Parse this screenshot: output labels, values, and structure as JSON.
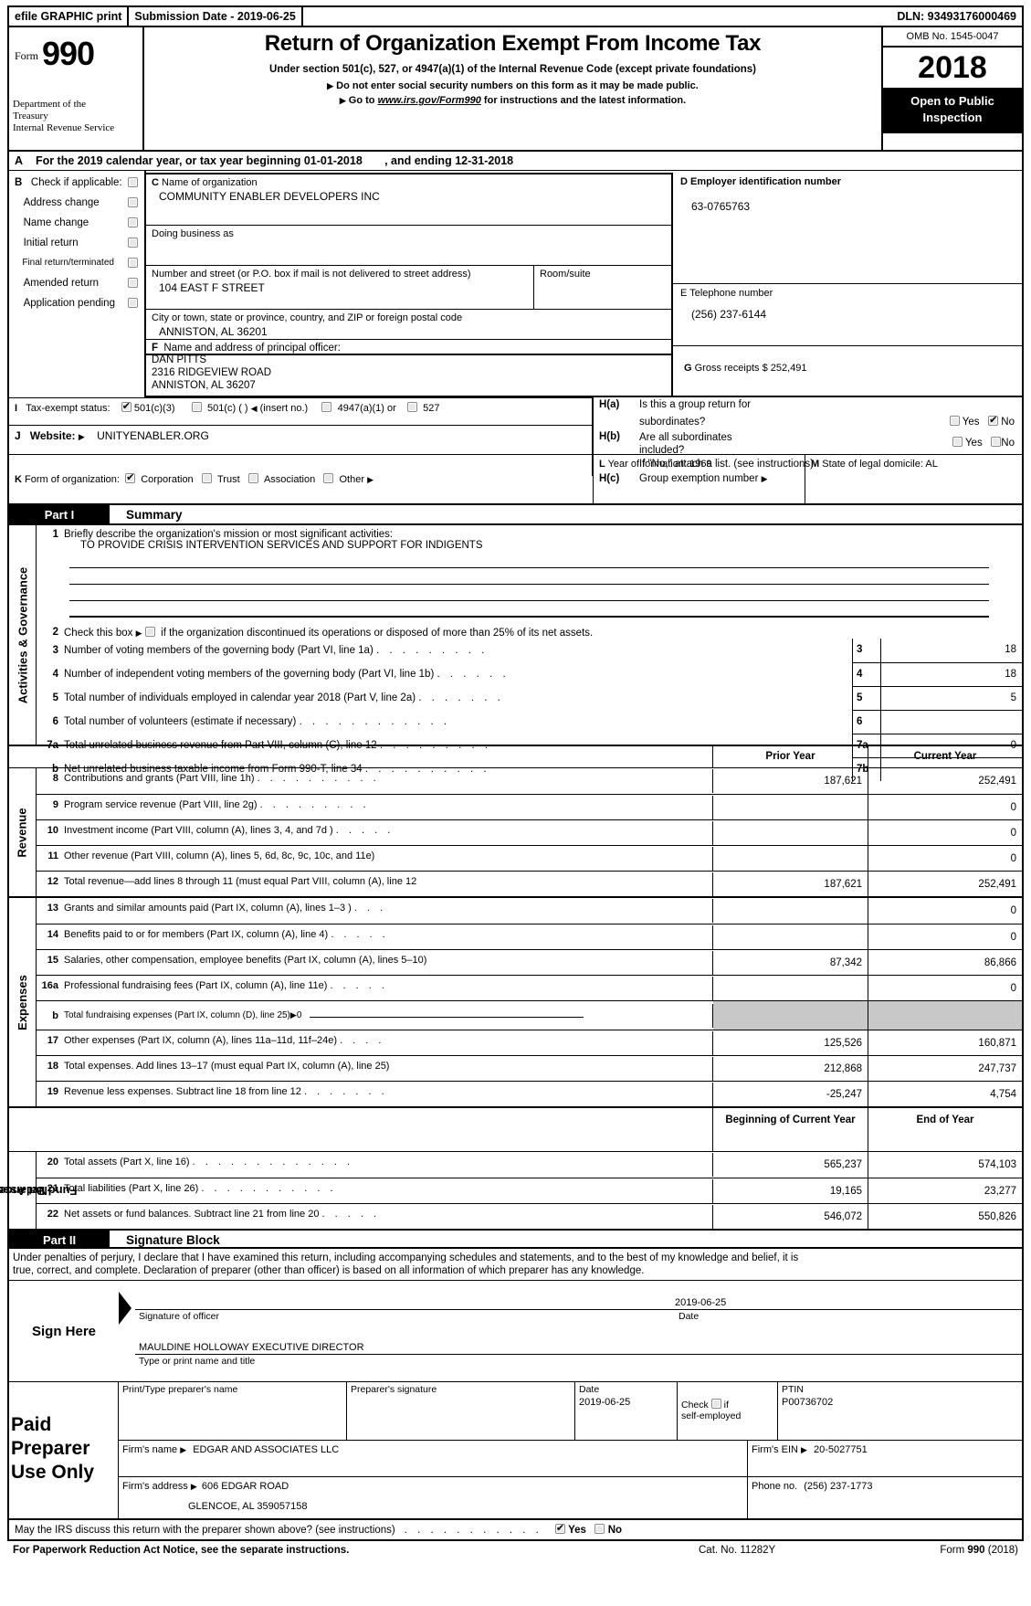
{
  "efile": {
    "graphic_print": "efile GRAPHIC print",
    "submission_label": "Submission Date - 2019-06-25",
    "dln": "DLN: 93493176000469"
  },
  "header": {
    "form_word": "Form",
    "form_number": "990",
    "department": "Department of the Treasury Internal Revenue Service",
    "dept_line1": "Department of the",
    "dept_line2": "Treasury",
    "dept_line3": "Internal Revenue Service",
    "title": "Return of Organization Exempt From Income Tax",
    "subtitle": "Under section 501(c), 527, or 4947(a)(1) of the Internal Revenue Code (except private foundations)",
    "bullet1": "Do not enter social security numbers on this form as it may be made public.",
    "bullet2_pre": "Go to ",
    "bullet2_link": "www.irs.gov/Form990",
    "bullet2_post": " for instructions and the latest information.",
    "omb": "OMB No. 1545-0047",
    "tax_year": "2018",
    "open_to_public_line1": "Open to Public",
    "open_to_public_line2": "Inspection"
  },
  "line_a": {
    "letter": "A",
    "text_pre": "For the 2019 calendar year, or tax year beginning",
    "begin_date": "01-01-2018",
    "text_mid": ", and ending",
    "end_date": "12-31-2018"
  },
  "section_b": {
    "letter": "B",
    "title": "Check if applicable:",
    "options": [
      {
        "label": "Address change",
        "checked": false
      },
      {
        "label": "Name change",
        "checked": false
      },
      {
        "label": "Initial return",
        "checked": false
      },
      {
        "label": "Final return/terminated",
        "checked": false
      },
      {
        "label": "Amended return",
        "checked": false
      },
      {
        "label": "Application pending",
        "checked": false
      }
    ]
  },
  "section_c": {
    "letter": "C",
    "name_label": "Name of organization",
    "org_name": "COMMUNITY ENABLER DEVELOPERS INC",
    "dba_label": "Doing business as",
    "dba_value": "",
    "street_label": "Number and street (or P.O. box if mail is not delivered to street address)",
    "street_value": "104 EAST F STREET",
    "room_label": "Room/suite",
    "room_value": "",
    "city_label": "City or town, state or province, country, and ZIP or foreign postal code",
    "city_value": "ANNISTON, AL   36201"
  },
  "section_d": {
    "label": "D Employer identification number",
    "letter": "D",
    "title": "Employer identification number",
    "value": "63-0765763"
  },
  "section_e": {
    "letter": "E",
    "title": "Telephone number",
    "value": "(256) 237-6144"
  },
  "section_f": {
    "letter": "F",
    "title": "Name and address of principal officer:",
    "name": "DAN PITTS",
    "street": "2316 RIDGEVIEW ROAD",
    "citystate": "ANNISTON, AL   36207"
  },
  "section_g": {
    "letter": "G",
    "label": "Gross receipts $",
    "value": "252,491"
  },
  "section_h": {
    "ha_letter": "H(a)",
    "ha_line1": "Is this a group return for",
    "ha_line2": "subordinates?",
    "ha_yes": "Yes",
    "ha_no": "No",
    "ha_yes_checked": false,
    "ha_no_checked": true,
    "hb_letter": "H(b)",
    "hb_line1": "Are all subordinates",
    "hb_line2": "included?",
    "hb_yes": "Yes",
    "hb_no": "No",
    "hb_yes_checked": false,
    "hb_no_checked": false,
    "hb_note": "If \"No,\" attach a list. (see instructions)",
    "hc_letter": "H(c)",
    "hc_label": "Group exemption number",
    "hc_value": ""
  },
  "section_i": {
    "letter": "I",
    "label": "Tax-exempt status:",
    "options": [
      {
        "label": "501(c)(3)",
        "checked": true
      },
      {
        "label": "501(c) (  )",
        "checked": false,
        "suffix": "(insert no.)"
      },
      {
        "label": "4947(a)(1) or",
        "checked": false
      },
      {
        "label": "527",
        "checked": false
      }
    ]
  },
  "section_j": {
    "letter": "J",
    "label": "Website:",
    "value": "UNITYENABLER.ORG"
  },
  "section_k": {
    "letter": "K",
    "label": "Form of organization:",
    "options": [
      {
        "label": "Corporation",
        "checked": true
      },
      {
        "label": "Trust",
        "checked": false
      },
      {
        "label": "Association",
        "checked": false
      },
      {
        "label": "Other",
        "checked": false
      }
    ]
  },
  "section_l": {
    "letter": "L",
    "label": "Year of formation:",
    "value": "1969"
  },
  "section_m": {
    "letter": "M",
    "label": "State of legal domicile:",
    "value": "AL"
  },
  "part1": {
    "part_label": "Part I",
    "title": "Summary",
    "vlabel_activities": "Activities & Governance",
    "vlabel_revenue": "Revenue",
    "vlabel_expenses": "Expenses",
    "vlabel_netassets_l1": "Net Assets or",
    "vlabel_netassets_l2": "Fund Balances",
    "line1_num": "1",
    "line1_text": "Briefly describe the organization's mission or most significant activities:",
    "mission": "TO PROVIDE CRISIS INTERVENTION SERVICES AND SUPPORT FOR INDIGENTS",
    "line2_num": "2",
    "line2_text_pre": "Check this box",
    "line2_text_post": "if the organization discontinued its operations or disposed of more than 25% of its net assets.",
    "line2_checked": false,
    "count_rows": [
      {
        "num": "3",
        "text": "Number of voting members of the governing body (Part VI, line 1a)",
        "dots": ".    .    .    .    .    .    .    .    .",
        "key": "3",
        "value": "18"
      },
      {
        "num": "4",
        "text": "Number of independent voting members of the governing body (Part VI, line 1b)",
        "dots": ".    .    .    .    .    .",
        "key": "4",
        "value": "18"
      },
      {
        "num": "5",
        "text": "Total number of individuals employed in calendar year 2018 (Part V, line 2a)",
        "dots": ".    .    .    .    .    .    .",
        "key": "5",
        "value": "5"
      },
      {
        "num": "6",
        "text": "Total number of volunteers (estimate if necessary)",
        "dots": ".    .    .    .    .    .    .    .    .    .    .    .",
        "key": "6",
        "value": ""
      },
      {
        "num": "7a",
        "text": "Total unrelated business revenue from Part VIII, column (C), line 12",
        "dots": ".    .    .    .    .    .    .    .    .",
        "key": "7a",
        "value": "0"
      },
      {
        "num": "b",
        "text": "Net unrelated business taxable income from Form 990-T, line 34",
        "dots": ".    .    .    .    .    .    .    .    .    .",
        "key": "7b",
        "value": ""
      }
    ],
    "col_prior": "Prior Year",
    "col_current": "Current Year",
    "col_begin": "Beginning of Current Year",
    "col_end": "End of Year",
    "revenue_rows": [
      {
        "num": "8",
        "text": "Contributions and grants (Part VIII, line 1h)",
        "dots": ".    .    .    .    .    .    .    .    .    .",
        "prior": "187,621",
        "current": "252,491"
      },
      {
        "num": "9",
        "text": "Program service revenue (Part VIII, line 2g)",
        "dots": ".    .    .    .    .    .    .    .    .",
        "prior": "",
        "current": "0"
      },
      {
        "num": "10",
        "text": "Investment income (Part VIII, column (A), lines 3, 4, and 7d )",
        "dots": ".    .    .    .    .",
        "prior": "",
        "current": "0"
      },
      {
        "num": "11",
        "text": "Other revenue (Part VIII, column (A), lines 5, 6d, 8c, 9c, 10c, and 11e)",
        "dots": "",
        "prior": "",
        "current": "0"
      },
      {
        "num": "12",
        "text": "Total revenue—add lines 8 through 11 (must equal Part VIII, column (A), line 12",
        "dots": "",
        "prior": "187,621",
        "current": "252,491"
      }
    ],
    "expense_rows": [
      {
        "num": "13",
        "text": "Grants and similar amounts paid (Part IX, column (A), lines 1–3 )",
        "dots": ".    .    .",
        "prior": "",
        "current": "0",
        "shaded": false
      },
      {
        "num": "14",
        "text": "Benefits paid to or for members (Part IX, column (A), line 4)",
        "dots": ".    .    .    .    .",
        "prior": "",
        "current": "0",
        "shaded": false
      },
      {
        "num": "15",
        "text": "Salaries, other compensation, employee benefits (Part IX, column (A), lines 5–10)",
        "dots": "",
        "prior": "87,342",
        "current": "86,866",
        "shaded": false
      },
      {
        "num": "16a",
        "text": "Professional fundraising fees (Part IX, column (A), line 11e)",
        "dots": ".    .    .    .    .",
        "prior": "",
        "current": "0",
        "shaded": false
      },
      {
        "num": "b",
        "text": "Total fundraising expenses (Part IX, column (D), line 25)",
        "dots": "",
        "prior": "",
        "current": "",
        "shaded": true,
        "fundraising_value": "0"
      },
      {
        "num": "17",
        "text": "Other expenses (Part IX, column (A), lines 11a–11d, 11f–24e)",
        "dots": ".    .    .    .",
        "prior": "125,526",
        "current": "160,871",
        "shaded": false
      },
      {
        "num": "18",
        "text": "Total expenses. Add lines 13–17 (must equal Part IX, column (A), line 25)",
        "dots": "",
        "prior": "212,868",
        "current": "247,737",
        "shaded": false
      },
      {
        "num": "19",
        "text": "Revenue less expenses. Subtract line 18 from line 12",
        "dots": ".    .    .    .    .    .    .",
        "prior": "-25,247",
        "current": "4,754",
        "shaded": false
      }
    ],
    "netasset_rows": [
      {
        "num": "20",
        "text": "Total assets (Part X, line 16)",
        "dots": ".    .    .    .    .    .    .    .    .    .    .    .    .",
        "begin": "565,237",
        "end": "574,103"
      },
      {
        "num": "21",
        "text": "Total liabilities (Part X, line 26)",
        "dots": ".    .    .    .    .    .    .    .    .    .    .",
        "begin": "19,165",
        "end": "23,277"
      },
      {
        "num": "22",
        "text": "Net assets or fund balances. Subtract line 21 from line 20",
        "dots": ".    .    .    .    .",
        "begin": "546,072",
        "end": "550,826"
      }
    ]
  },
  "part2": {
    "part_label": "Part II",
    "title": "Signature Block",
    "perjury_line1": "Under penalties of perjury, I declare that I have examined this return, including accompanying schedules and statements, and to the best of my knowledge and belief, it is",
    "perjury_line2": "true, correct, and complete. Declaration of preparer (other than officer) is based on all information of which preparer has any knowledge.",
    "sign_here": "Sign Here",
    "officer_sig_caption": "Signature of officer",
    "date_caption": "Date",
    "officer_date": "2019-06-25",
    "officer_name_title": "MAULDINE HOLLOWAY  EXECUTIVE DIRECTOR",
    "type_print_caption": "Type or print name and title"
  },
  "preparer": {
    "block_l1": "Paid",
    "block_l2": "Preparer",
    "block_l3": "Use Only",
    "name_caption": "Print/Type preparer's name",
    "name_value": "",
    "sig_caption": "Preparer's signature",
    "sig_value": "",
    "date_caption": "Date",
    "date_value": "2019-06-25",
    "check_label_1": "Check",
    "check_label_2": "if",
    "check_label_3": "self-employed",
    "self_employed_checked": false,
    "ptin_caption": "PTIN",
    "ptin_value": "P00736702",
    "firm_name_caption": "Firm's name",
    "firm_name_value": "EDGAR AND ASSOCIATES LLC",
    "firm_ein_caption": "Firm's EIN",
    "firm_ein_value": "20-5027751",
    "firm_address_caption": "Firm's address",
    "firm_address_value": "606 EDGAR ROAD",
    "firm_address_value2": "GLENCOE, AL   359057158",
    "phone_caption": "Phone no.",
    "phone_value": "(256) 237-1773"
  },
  "footer": {
    "discuss_text": "May the IRS discuss this return with the preparer shown above? (see instructions)",
    "discuss_dots": ".    .    .    .    .    .    .    .    .    .    .",
    "yes": "Yes",
    "no": "No",
    "yes_checked": true,
    "no_checked": false,
    "paperwork": "For Paperwork Reduction Act Notice, see the separate instructions.",
    "cat_no": "Cat. No. 11282Y",
    "form_ref_pre": "Form ",
    "form_ref_num": "990",
    "form_ref_post": " (2018)"
  }
}
